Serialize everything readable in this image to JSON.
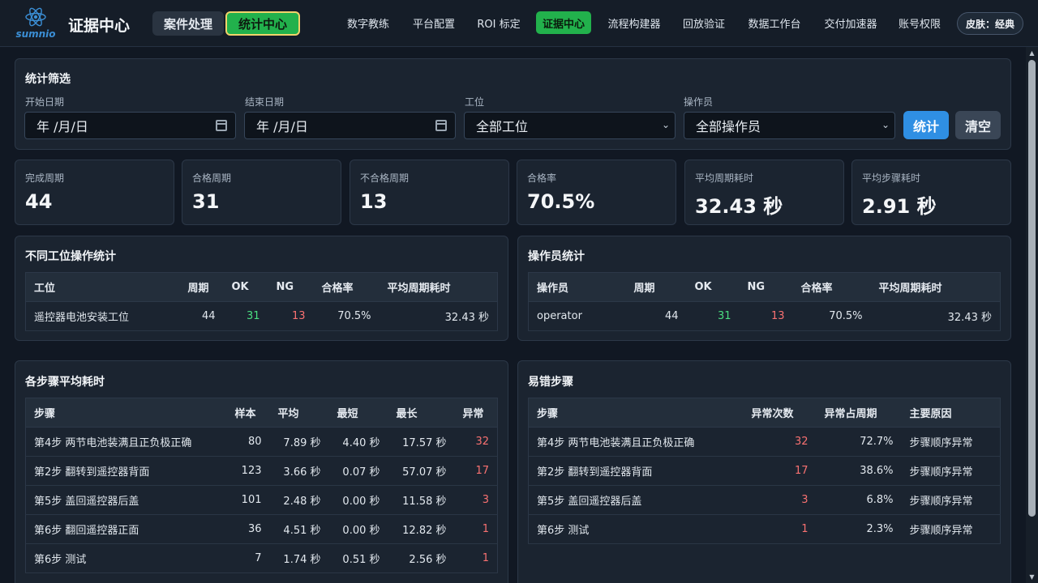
{
  "header": {
    "logo_text": "sumnio",
    "app_title": "证据中心",
    "mode_buttons": [
      "案件处理",
      "统计中心"
    ],
    "nav": [
      "数字教练",
      "平台配置",
      "ROI 标定",
      "证据中心",
      "流程构建器",
      "回放验证",
      "数据工作台",
      "交付加速器",
      "账号权限"
    ],
    "skin_label": "皮肤：经典"
  },
  "filters": {
    "title": "统计筛选",
    "start_label": "开始日期",
    "start_value": "年 /月/日",
    "end_label": "结束日期",
    "end_value": "年 /月/日",
    "station_label": "工位",
    "station_value": "全部工位",
    "operator_label": "操作员",
    "operator_value": "全部操作员",
    "stat_button": "统计",
    "clear_button": "清空"
  },
  "summary": [
    {
      "label": "完成周期",
      "value": "44"
    },
    {
      "label": "合格周期",
      "value": "31"
    },
    {
      "label": "不合格周期",
      "value": "13"
    },
    {
      "label": "合格率",
      "value": "70.5%"
    },
    {
      "label": "平均周期耗时",
      "value": "32.43 秒"
    },
    {
      "label": "平均步骤耗时",
      "value": "2.91 秒"
    }
  ],
  "station_stats": {
    "title": "不同工位操作统计",
    "headers": [
      "工位",
      "周期",
      "OK",
      "NG",
      "合格率",
      "平均周期耗时"
    ],
    "rows": [
      [
        "遥控器电池安装工位",
        "44",
        "31",
        "13",
        "70.5%",
        "32.43 秒"
      ]
    ]
  },
  "operator_stats": {
    "title": "操作员统计",
    "headers": [
      "操作员",
      "周期",
      "OK",
      "NG",
      "合格率",
      "平均周期耗时"
    ],
    "rows": [
      [
        "operator",
        "44",
        "31",
        "13",
        "70.5%",
        "32.43 秒"
      ]
    ]
  },
  "step_stats": {
    "title": "各步骤平均耗时",
    "headers": [
      "步骤",
      "样本",
      "平均",
      "最短",
      "最长",
      "异常"
    ],
    "rows": [
      [
        "第4步 两节电池装满且正负极正确",
        "80",
        "7.89 秒",
        "4.40 秒",
        "17.57 秒",
        "32"
      ],
      [
        "第2步 翻转到遥控器背面",
        "123",
        "3.66 秒",
        "0.07 秒",
        "57.07 秒",
        "17"
      ],
      [
        "第5步 盖回遥控器后盖",
        "101",
        "2.48 秒",
        "0.00 秒",
        "11.58 秒",
        "3"
      ],
      [
        "第6步 翻回遥控器正面",
        "36",
        "4.51 秒",
        "0.00 秒",
        "12.82 秒",
        "1"
      ],
      [
        "第6步 测试",
        "7",
        "1.74 秒",
        "0.51 秒",
        "2.56 秒",
        "1"
      ]
    ]
  },
  "error_steps": {
    "title": "易错步骤",
    "headers": [
      "步骤",
      "异常次数",
      "异常占周期",
      "主要原因"
    ],
    "rows": [
      [
        "第4步 两节电池装满且正负极正确",
        "32",
        "72.7%",
        "步骤顺序异常"
      ],
      [
        "第2步 翻转到遥控器背面",
        "17",
        "38.6%",
        "步骤顺序异常"
      ],
      [
        "第5步 盖回遥控器后盖",
        "3",
        "6.8%",
        "步骤顺序异常"
      ],
      [
        "第6步 测试",
        "1",
        "2.3%",
        "步骤顺序异常"
      ]
    ]
  }
}
